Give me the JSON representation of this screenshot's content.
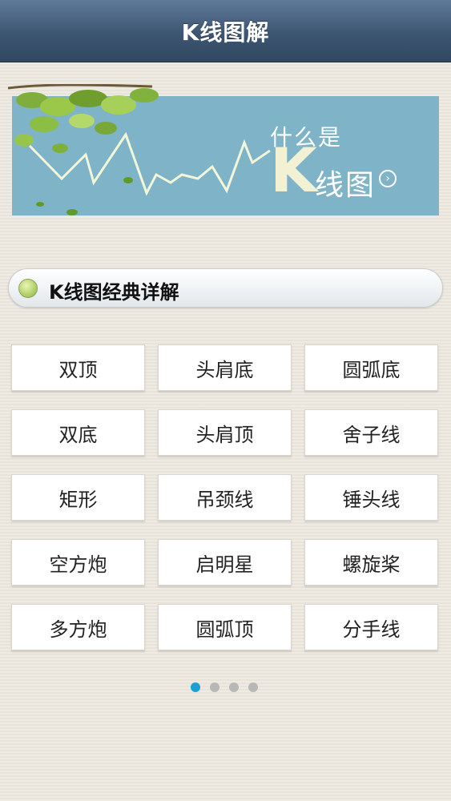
{
  "header": {
    "title": "K线图解"
  },
  "banner": {
    "question": "什么是",
    "letter": "K",
    "suffix": "线图",
    "arrow_icon": "arrow-right-circle-icon"
  },
  "section": {
    "title": "K线图经典详解"
  },
  "patterns": [
    "双顶",
    "头肩底",
    "圆弧底",
    "双底",
    "头肩顶",
    "舍子线",
    "矩形",
    "吊颈线",
    "锤头线",
    "空方炮",
    "启明星",
    "螺旋桨",
    "多方炮",
    "圆弧顶",
    "分手线"
  ],
  "pagination": {
    "total": 4,
    "active": 1
  },
  "colors": {
    "navbar": "#3c5572",
    "banner": "#7fb4c8",
    "accent_dot": "#1a9fd6"
  }
}
